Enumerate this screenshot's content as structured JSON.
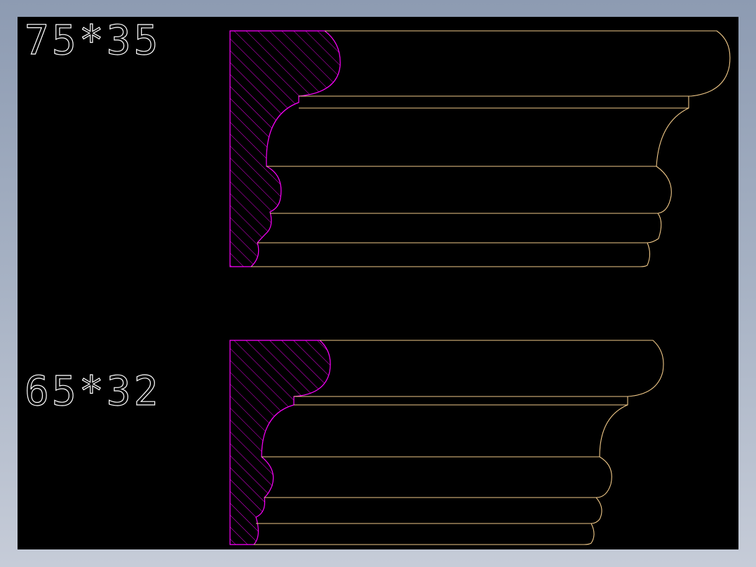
{
  "labels": {
    "top_profile": "75*35",
    "bottom_profile": "65*32"
  },
  "colors": {
    "frame_bg": "#8d9bb2",
    "canvas_bg": "#000000",
    "section_outline": "#ff00ff",
    "profile_outline": "#f0c888",
    "hatch": "#ff00ff",
    "text": "#ffffff"
  }
}
